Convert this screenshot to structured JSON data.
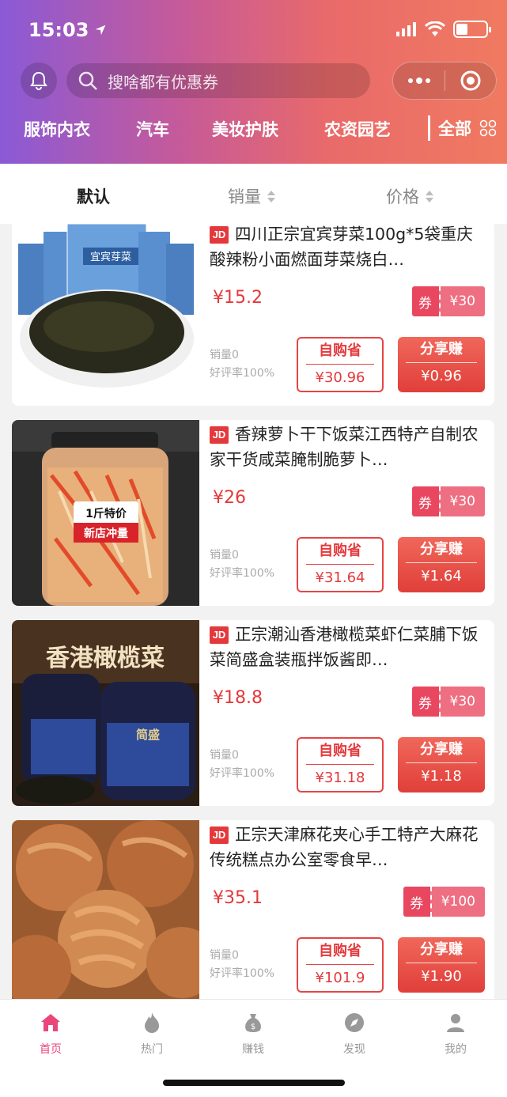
{
  "status_bar": {
    "time": "15:03"
  },
  "header": {
    "search_placeholder": "搜啥都有优惠券",
    "categories": [
      "服饰内衣",
      "汽车",
      "美妆护肤",
      "农资园艺"
    ],
    "all_label": "全部"
  },
  "sort_tabs": [
    {
      "label": "默认",
      "active": true
    },
    {
      "label": "销量",
      "active": false
    },
    {
      "label": "价格",
      "active": false
    }
  ],
  "products": [
    {
      "badge": "JD",
      "title": "四川正宗宜宾芽菜100g*5袋重庆酸辣粉小面燃面芽菜烧白…",
      "price": "¥15.2",
      "coupon_label": "券",
      "coupon_value": "¥30",
      "sales": "销量0",
      "rating": "好评率100%",
      "self_label": "自购省",
      "self_value": "¥30.96",
      "share_label": "分享赚",
      "share_value": "¥0.96",
      "image_text": [
        "宜宾芽菜"
      ]
    },
    {
      "badge": "JD",
      "title": "香辣萝卜干下饭菜江西特产自制农家干货咸菜腌制脆萝卜…",
      "price": "¥26",
      "coupon_label": "券",
      "coupon_value": "¥30",
      "sales": "销量0",
      "rating": "好评率100%",
      "self_label": "自购省",
      "self_value": "¥31.64",
      "share_label": "分享赚",
      "share_value": "¥1.64",
      "image_text": [
        "1斤特价",
        "新店冲量"
      ]
    },
    {
      "badge": "JD",
      "title": "正宗潮汕香港橄榄菜虾仁菜脯下饭菜简盛盒装瓶拌饭酱即…",
      "price": "¥18.8",
      "coupon_label": "券",
      "coupon_value": "¥30",
      "sales": "销量0",
      "rating": "好评率100%",
      "self_label": "自购省",
      "self_value": "¥31.18",
      "share_label": "分享赚",
      "share_value": "¥1.18",
      "image_text": [
        "香港橄榄菜",
        "简盛"
      ]
    },
    {
      "badge": "JD",
      "title": "正宗天津麻花夹心手工特产大麻花传统糕点办公室零食早…",
      "price": "¥35.1",
      "coupon_label": "券",
      "coupon_value": "¥100",
      "sales": "销量0",
      "rating": "好评率100%",
      "self_label": "自购省",
      "self_value": "¥101.9",
      "share_label": "分享赚",
      "share_value": "¥1.90",
      "image_text": []
    }
  ],
  "tabbar": [
    {
      "label": "首页",
      "icon": "home-icon",
      "active": true
    },
    {
      "label": "热门",
      "icon": "flame-icon",
      "active": false
    },
    {
      "label": "赚钱",
      "icon": "money-bag-icon",
      "active": false
    },
    {
      "label": "发现",
      "icon": "compass-icon",
      "active": false
    },
    {
      "label": "我的",
      "icon": "user-icon",
      "active": false
    }
  ],
  "colors": {
    "accent": "#e4393c",
    "tab_active": "#e9477a"
  }
}
